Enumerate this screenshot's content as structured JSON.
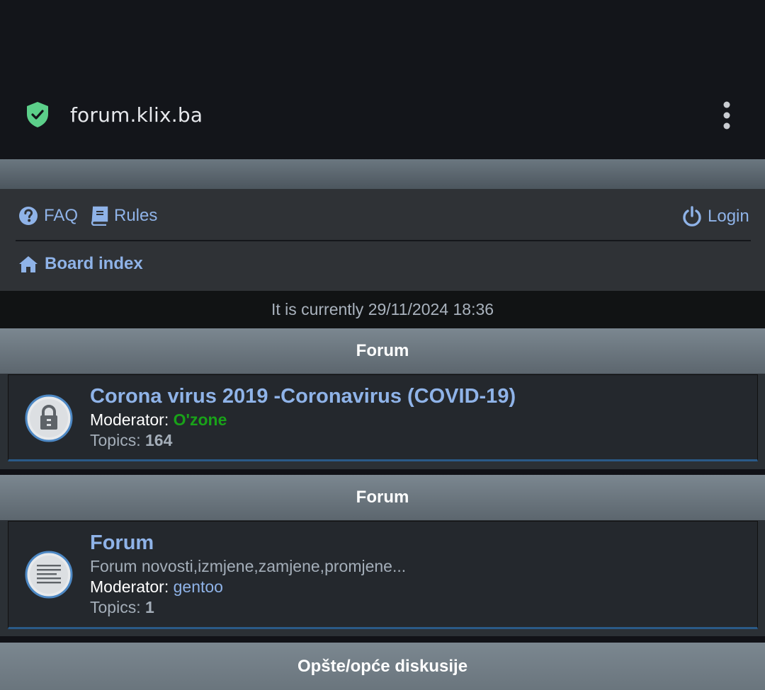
{
  "browser": {
    "url": "forum.klix.ba",
    "shield_color": "#5ccf8a"
  },
  "nav": {
    "faq_label": "FAQ",
    "rules_label": "Rules",
    "login_label": "Login",
    "board_index_label": "Board index"
  },
  "time": {
    "text": "It is currently 29/11/2024 18:36"
  },
  "sections": [
    {
      "header": "Forum",
      "forums": [
        {
          "title": "Corona virus 2019 -Coronavirus (COVID-19)",
          "icon": "lock-icon",
          "moderator_label": "Moderator: ",
          "moderator": "O'zone",
          "moderator_color": "#19a219",
          "topics_label": "Topics: ",
          "topics": "164"
        }
      ]
    },
    {
      "header": "Forum",
      "forums": [
        {
          "title": "Forum",
          "icon": "document-icon",
          "description": "Forum novosti,izmjene,zamjene,promjene...",
          "moderator_label": "Moderator: ",
          "moderator": "gentoo",
          "moderator_color": "#8fb3e8",
          "topics_label": "Topics: ",
          "topics": "1"
        }
      ]
    },
    {
      "header": "Opšte/opće diskusije",
      "forums": []
    }
  ],
  "colors": {
    "link": "#8fb3e8",
    "accent_border": "#2a5a88"
  }
}
